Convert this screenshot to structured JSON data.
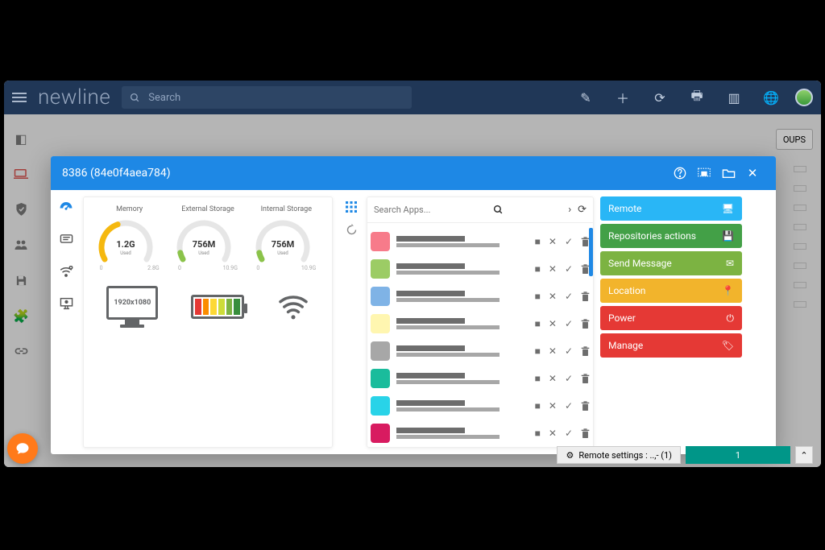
{
  "brand": "newline",
  "search_placeholder": "Search",
  "groups_button": "OUPS",
  "footer": {
    "label": "Remote settings : ..,- (1)",
    "count": "1"
  },
  "modal": {
    "title": "8386 (84e0f4aea784)",
    "gauges": [
      {
        "title": "Memory",
        "value": "1.2G",
        "sub": "Used",
        "min": "0",
        "max": "2.8G",
        "color": "#f5b80f",
        "pct": 0.42
      },
      {
        "title": "External Storage",
        "value": "756M",
        "sub": "Used",
        "min": "0",
        "max": "10.9G",
        "color": "#8bc34a",
        "pct": 0.07
      },
      {
        "title": "Internal Storage",
        "value": "756M",
        "sub": "Used",
        "min": "0",
        "max": "10.9G",
        "color": "#8bc34a",
        "pct": 0.07
      }
    ],
    "resolution": "1920x1080",
    "battery_cells": [
      "#e53935",
      "#fb8c00",
      "#fdd835",
      "#cddc39",
      "#7cb342",
      "#388e3c"
    ],
    "apps_search_placeholder": "Search Apps...",
    "app_colors": [
      "#f77b8a",
      "#9ccc65",
      "#7fb3e6",
      "#fff6b0",
      "#a7a7a7",
      "#1abc9c",
      "#29d3e8",
      "#d81b60"
    ],
    "actions": [
      {
        "label": "Remote",
        "color": "#29b6f6",
        "icon": "🖥"
      },
      {
        "label": "Repositories actions",
        "color": "#43a047",
        "icon": "💾"
      },
      {
        "label": "Send Message",
        "color": "#7cb342",
        "icon": "✉"
      },
      {
        "label": "Location",
        "color": "#f2b42c",
        "icon": "📍"
      },
      {
        "label": "Power",
        "color": "#e53935",
        "icon": "⏻"
      },
      {
        "label": "Manage",
        "color": "#e53935",
        "icon": "🏷"
      }
    ]
  }
}
